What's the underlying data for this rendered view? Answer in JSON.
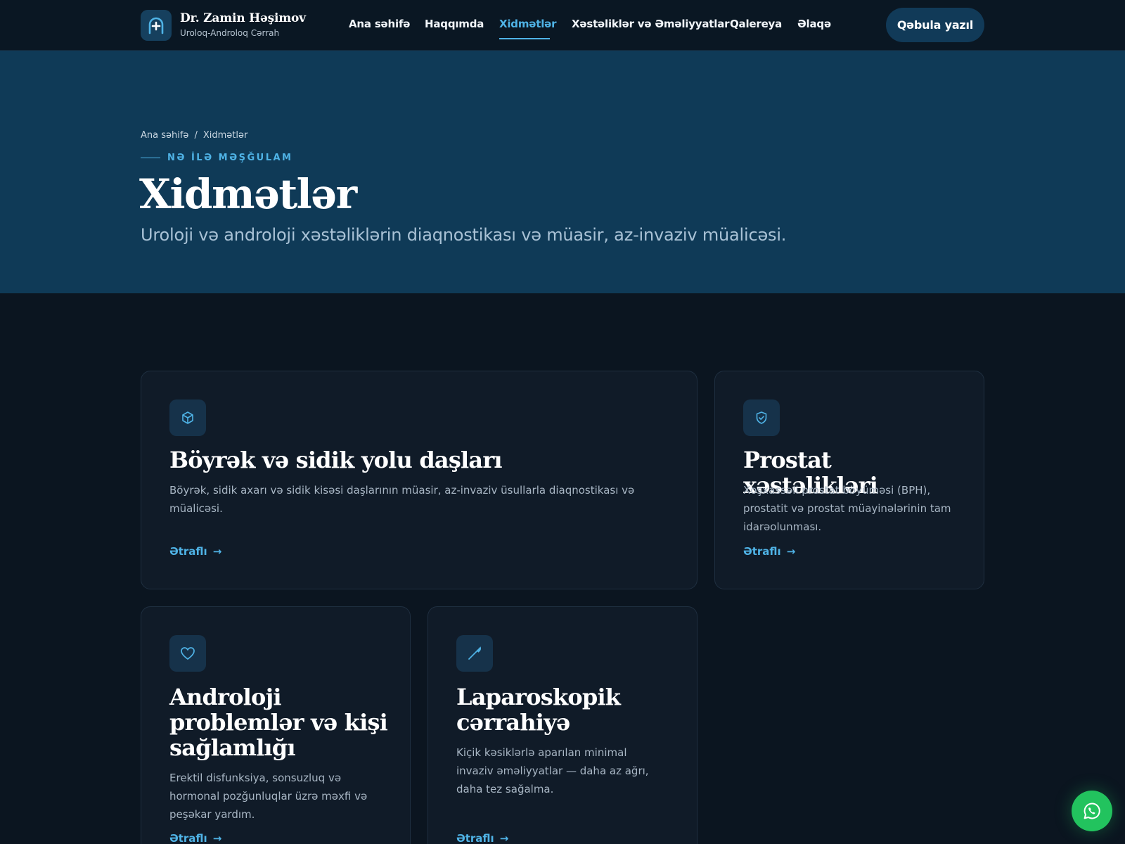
{
  "header": {
    "brand_name": "Dr. Zamin Həşimov",
    "brand_sub": "Uroloq-Androloq Cərrah",
    "nav": [
      {
        "label": "Ana səhifə"
      },
      {
        "label": "Haqqımda"
      },
      {
        "label": "Xidmətlər",
        "active": true
      },
      {
        "label": "Xəstəliklər və Əməliyyatlar"
      },
      {
        "label": "Qalereya"
      },
      {
        "label": "Əlaqə"
      }
    ],
    "cta_label": "Qəbula yazıl"
  },
  "hero": {
    "breadcrumb": [
      "Ana səhifə",
      "/",
      "Xidmətlər"
    ],
    "eyebrow": "NƏ İLƏ MƏŞĞULAM",
    "title": "Xidmətlər",
    "subtitle": "Uroloji və androloji xəstəliklərin diaqnostikası və müasir, az-invaziv müalicəsi."
  },
  "services": [
    {
      "icon": "cube-icon",
      "title": "Böyrək və sidik yolu daşları",
      "description": "Böyrək, sidik axarı və sidik kisəsi daşlarının müasir, az-invaziv üsullarla diaqnostikası və müalicəsi.",
      "link": "Ətraflı"
    },
    {
      "icon": "shield-check-icon",
      "title": "Prostat xəstəlikləri",
      "description": "Xoşxassəli prostat böyüməsi (BPH), prostatit və prostat müayinələrinin tam idarəolunması.",
      "link": "Ətraflı"
    },
    {
      "icon": "heart-icon",
      "title": "Androloji problemlər və kişi sağlamlığı",
      "description": "Erektil disfunksiya, sonsuzluq və hormonal pozğunluqlar üzrə məxfi və peşəkar yardım.",
      "link": "Ətraflı"
    },
    {
      "icon": "scalpel-icon",
      "title": "Laparoskopik cərrahiyə",
      "description": "Kiçik kəsiklərlə aparılan minimal invaziv əməliyyatlar — daha az ağrı, daha tez sağalma.",
      "link": "Ətraflı"
    }
  ],
  "floating": {
    "icon": "whatsapp-icon"
  },
  "colors": {
    "accent": "#4fb3e6",
    "hero_bg": "#0f3a57",
    "page_bg": "#0b1520",
    "whatsapp": "#22c35e"
  }
}
